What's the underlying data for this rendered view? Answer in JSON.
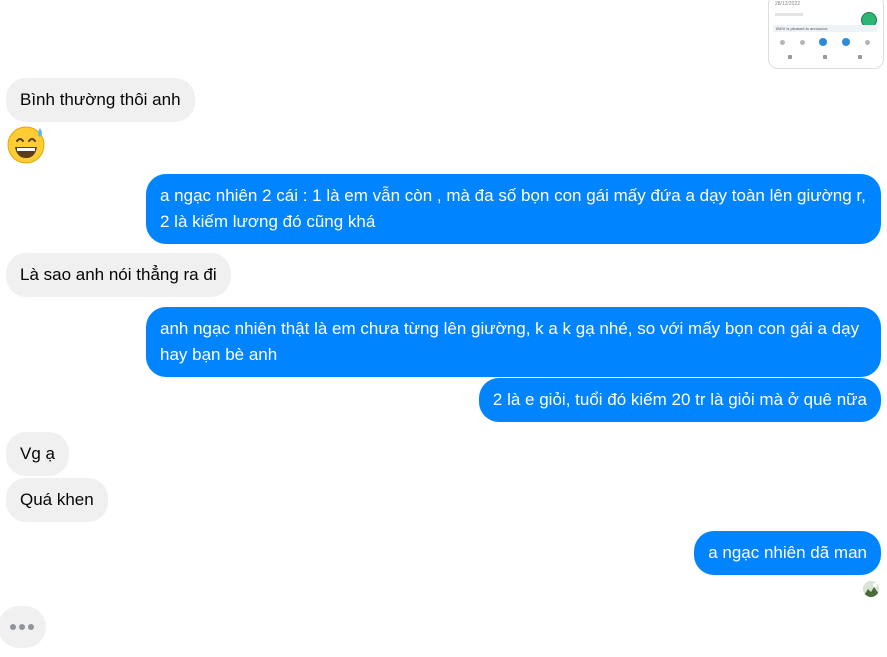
{
  "thumbnail": {
    "date": "28/12/2022",
    "announcement": "IBDV is pleased to announce",
    "badge_color": "#2bb673",
    "nav_highlight_color": "#2a8bd8"
  },
  "colors": {
    "outgoing_bubble": "#0084ff",
    "incoming_bubble": "#f0f0f0"
  },
  "messages": [
    {
      "sender": "other",
      "text": "Bình thường thôi anh"
    },
    {
      "sender": "other",
      "emoji": "grinning-face-with-sweat-icon"
    },
    {
      "sender": "me",
      "text": "a ngạc nhiên 2 cái : 1 là em vẫn còn , mà đa số bọn con gái mấy đứa a dạy toàn lên giường r, 2 là kiếm lương đó cũng khá"
    },
    {
      "sender": "other",
      "text": "Là sao anh nói thẳng ra đi"
    },
    {
      "sender": "me",
      "text": "anh ngạc nhiên thật là em chưa từng lên giường, k a k gạ nhé, so với mấy bọn con gái a dạy hay bạn bè anh"
    },
    {
      "sender": "me",
      "text": "2 là e giỏi, tuổi đó kiếm 20 tr là giỏi mà ở quê nữa"
    },
    {
      "sender": "other",
      "text": "Vg ạ"
    },
    {
      "sender": "other",
      "text": "Quá khen"
    },
    {
      "sender": "me",
      "text": "a ngạc nhiên dã man"
    }
  ],
  "typing_indicator": "typing-dots-icon",
  "read_receipt": "seen-avatar-icon"
}
